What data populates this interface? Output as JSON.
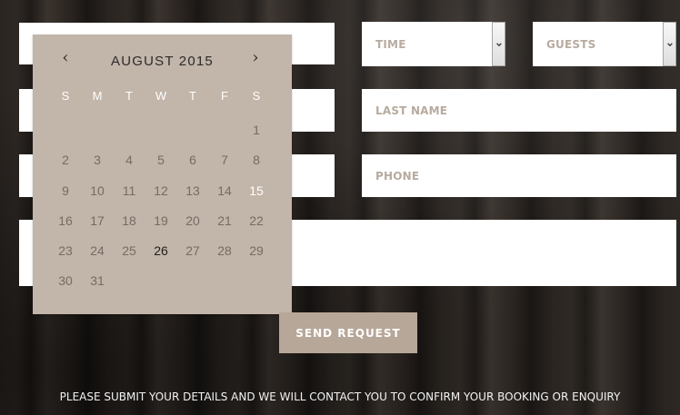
{
  "form": {
    "time_select": {
      "selected": "TIME"
    },
    "guests_select": {
      "selected": "GUESTS"
    },
    "last_name_placeholder": "LAST NAME",
    "phone_placeholder": "PHONE",
    "send_button": "SEND REQUEST"
  },
  "datepicker": {
    "prev_symbol": "‹",
    "next_symbol": "›",
    "month_title": "AUGUST 2015",
    "weekday_headers": [
      "S",
      "M",
      "T",
      "W",
      "T",
      "F",
      "S"
    ],
    "weeks": [
      [
        "",
        "",
        "",
        "",
        "",
        "",
        "1"
      ],
      [
        "2",
        "3",
        "4",
        "5",
        "6",
        "7",
        "8"
      ],
      [
        "9",
        "10",
        "11",
        "12",
        "13",
        "14",
        "15"
      ],
      [
        "16",
        "17",
        "18",
        "19",
        "20",
        "21",
        "22"
      ],
      [
        "23",
        "24",
        "25",
        "26",
        "27",
        "28",
        "29"
      ],
      [
        "30",
        "31",
        "",
        "",
        "",
        "",
        ""
      ]
    ],
    "highlighted_day": "15",
    "today_day": "26"
  },
  "footer": {
    "note": "PLEASE SUBMIT YOUR DETAILS AND WE WILL CONTACT YOU TO CONFIRM YOUR BOOKING OR ENQUIRY"
  },
  "theme": {
    "calendar_bg": "#c2b5a9",
    "button_bg": "#b7a798",
    "placeholder_color": "#b7ab9f",
    "day_text": "#746c66",
    "highlight_text": "#ffffff",
    "today_text": "#1f1f1f"
  },
  "icons": {
    "select_arrow": "chevron-down-icon",
    "calendar_prev": "chevron-left-icon",
    "calendar_next": "chevron-right-icon"
  }
}
